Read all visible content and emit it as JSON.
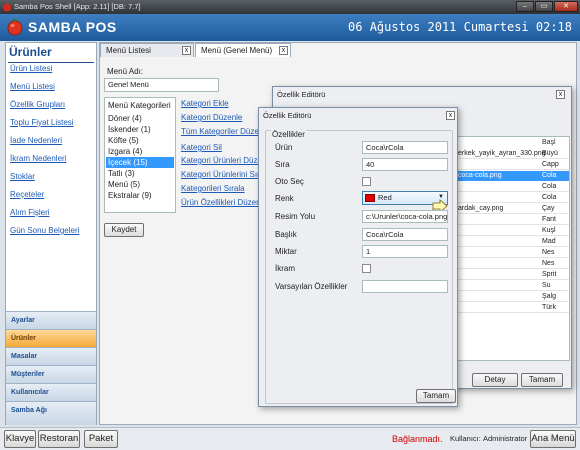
{
  "window": {
    "title": "Samba Pos Shell [App: 2.11] [DB: 7.7]"
  },
  "header": {
    "brand": "SAMBA POS",
    "date": "06 Ağustos 2011 Cumartesi 02:18"
  },
  "sidebar": {
    "title": "Ürünler",
    "links": [
      "Ürün Listesi",
      "Menü Listesi",
      "Özellik Grupları",
      "Toplu Fiyat Listesi",
      "İade Nedenleri",
      "İkram Nedenleri",
      "Stoklar",
      "Reçeteler",
      "Alım Fişleri",
      "Gün Sonu Belgeleri"
    ],
    "sections": [
      "Ayarlar",
      "Ürünler",
      "Masalar",
      "Müşteriler",
      "Kullanıcılar",
      "Samba Ağı"
    ]
  },
  "tabs": [
    "Menü Listesi",
    "Menü (Genel Menü)"
  ],
  "menu_form": {
    "name_label": "Menü Adı:",
    "name_value": "Genel Menü",
    "categories_header": "Menü Kategorileri",
    "categories": [
      "Döner (4)",
      "İskender (1)",
      "Köfte (5)",
      "Izgara (4)",
      "İçecek (15)",
      "Tatlı (3)",
      "Menü (5)",
      "Ekstralar (9)"
    ],
    "actions": [
      "Kategori Ekle",
      "Kategori Düzenle",
      "Tüm Kategoriler Düzen",
      "Kategori Sil",
      "Kategori Ürünleri Düzen",
      "Kategori Ürünlerini Sır",
      "Kategorileri Sırala",
      "Ürün Özellikleri Düzen"
    ],
    "save_label": "Kaydet"
  },
  "back_dialog": {
    "title": "Özellik Editörü",
    "col_header": "Başl",
    "rows": [
      {
        "img": "erkek_yayik_ayran_330.png",
        "name": "Büyü"
      },
      {
        "img": "",
        "name": "Capp"
      },
      {
        "img": "coca-cola.png",
        "name": "Cola"
      },
      {
        "img": "",
        "name": "Cola"
      },
      {
        "img": "",
        "name": "Cola"
      },
      {
        "img": "ardak_cay.png",
        "name": "Çay"
      },
      {
        "img": "",
        "name": "Fant"
      },
      {
        "img": "",
        "name": "Kuşl"
      },
      {
        "img": "",
        "name": "Mad"
      },
      {
        "img": "",
        "name": "Nes"
      },
      {
        "img": "",
        "name": "Nes"
      },
      {
        "img": "",
        "name": "Sprit"
      },
      {
        "img": "",
        "name": "Su"
      },
      {
        "img": "",
        "name": "Şalg"
      },
      {
        "img": "",
        "name": "Türk"
      }
    ],
    "detail_label": "Detay",
    "ok_label": "Tamam"
  },
  "front_dialog": {
    "title": "Özellik Editörü",
    "group_label": "Özellikler",
    "fields": {
      "urun_label": "Ürün",
      "urun_value": "Coca\\rCola",
      "sira_label": "Sıra",
      "sira_value": "40",
      "otoseç_label": "Oto Seç",
      "renk_label": "Renk",
      "renk_value": "Red",
      "renk_color": "#e00000",
      "resim_label": "Resim Yolu",
      "resim_value": "c:\\Urunler\\coca-cola.png",
      "baslik_label": "Başlık",
      "baslik_value": "Coca\\rCola",
      "miktar_label": "Miktar",
      "miktar_value": "1",
      "ikram_label": "İkram",
      "varsayilan_label": "Varsayılan Özellikler",
      "varsayilan_value": ""
    },
    "ok_label": "Tamam"
  },
  "statusbar": {
    "buttons": [
      "Klavye",
      "Restoran",
      "Paket"
    ],
    "connection": "Bağlanmadı.",
    "user_label": "Kullanıcı:",
    "user": "Administrator",
    "main_menu": "Ana Menü"
  }
}
